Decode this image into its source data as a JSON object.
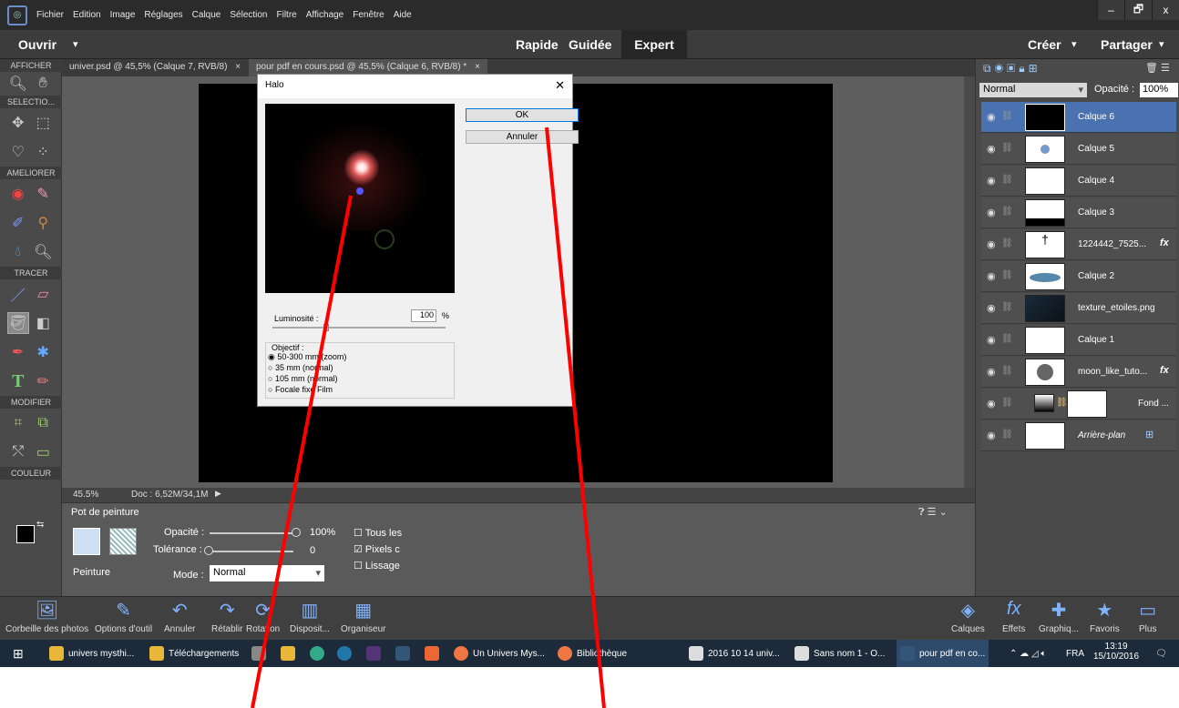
{
  "menu": [
    "Fichier",
    "Edition",
    "Image",
    "Réglages",
    "Calque",
    "Sélection",
    "Filtre",
    "Affichage",
    "Fenêtre",
    "Aide"
  ],
  "window_controls": {
    "minimize": "–",
    "maximize": "🗗",
    "close": "x"
  },
  "modebar": {
    "open": "Ouvrir",
    "modes": [
      "Rapide",
      "Guidée",
      "Expert"
    ],
    "create": "Créer",
    "share": "Partager"
  },
  "tools": {
    "sections": [
      "AFFICHER",
      "SELECTIO...",
      "AMELIORER",
      "TRACER",
      "MODIFIER",
      "COULEUR"
    ]
  },
  "tabs": [
    "univer.psd @ 45,5% (Calque 7, RVB/8)",
    "pour pdf en cours.psd @ 45,5% (Calque 6, RVB/8) *"
  ],
  "status": {
    "zoom": "45.5%",
    "doc": "Doc : 6,52M/34,1M"
  },
  "tool_options": {
    "tool_name": "Pot de peinture",
    "preset_label": "Peinture",
    "opacity_label": "Opacité :",
    "opacity_value": "100%",
    "tolerance_label": "Tolérance :",
    "tolerance_value": "0",
    "mode_label": "Mode :",
    "mode_value": "Normal",
    "checks": [
      "Tous les",
      "Pixels c",
      "Lissage"
    ]
  },
  "bottom_left": [
    "Corbeille des photos",
    "Options d'outil",
    "Annuler",
    "Rétablir",
    "Rotation",
    "Disposit...",
    "Organiseur"
  ],
  "bottom_right": [
    "Calques",
    "Effets",
    "Graphiq...",
    "Favoris",
    "Plus"
  ],
  "layers_panel": {
    "blend": "Normal",
    "opacity_label": "Opacité :",
    "opacity_value": "100%",
    "layers": [
      {
        "name": "Calque 6",
        "selected": true
      },
      {
        "name": "Calque 5"
      },
      {
        "name": "Calque 4"
      },
      {
        "name": "Calque 3"
      },
      {
        "name": "1224442_7525...",
        "fx": "fx"
      },
      {
        "name": "Calque 2"
      },
      {
        "name": "texture_etoiles.png"
      },
      {
        "name": "Calque 1"
      },
      {
        "name": "moon_like_tuto...",
        "fx": "fx"
      },
      {
        "name": "Fond ..."
      },
      {
        "name": "Arrière-plan"
      }
    ]
  },
  "dialog": {
    "title": "Halo",
    "ok": "OK",
    "cancel": "Annuler",
    "brightness_label": "Luminosité :",
    "brightness_value": "100",
    "percent": "%",
    "lens_label": "Objectif :",
    "lens_options": [
      "50-300 mm (zoom)",
      "35 mm (normal)",
      "105 mm (normal)",
      "Focale fixe Film"
    ],
    "selected_lens": 0
  },
  "taskbar": {
    "items": [
      "univers mysthi...",
      "Téléchargements",
      "Un Univers Mys...",
      "Bibliothèque",
      "2016 10 14 univ...",
      "Sans nom 1 - O...",
      "pour pdf en co..."
    ],
    "lang": "FRA",
    "time": "13:19",
    "date": "15/10/2016"
  }
}
